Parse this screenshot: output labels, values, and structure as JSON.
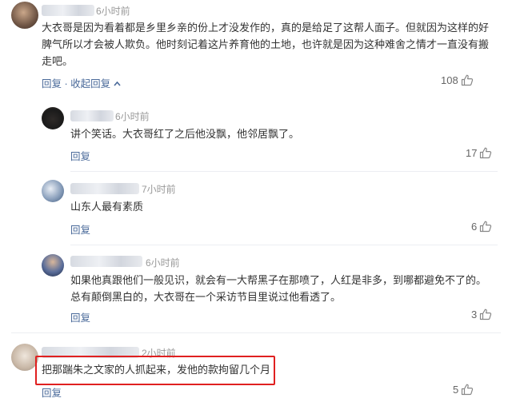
{
  "comments": [
    {
      "time": "6小时前",
      "text": "大衣哥是因为看着都是乡里乡亲的份上才没发作的，真的是给足了这帮人面子。但就因为这样的好脾气所以才会被人欺负。他时刻记着这片养育他的土地，也许就是因为这种难舍之情才一直没有搬走吧。",
      "reply_label": "回复",
      "separator": "·",
      "collapse_label": "收起回复",
      "collapse_icon": "chevron-up-icon",
      "likes": "108"
    },
    {
      "time": "6小时前",
      "text": "讲个笑话。大衣哥红了之后他没飘，他邻居飘了。",
      "reply_label": "回复",
      "likes": "17"
    },
    {
      "time": "7小时前",
      "text": "山东人最有素质",
      "reply_label": "回复",
      "likes": "6"
    },
    {
      "time": "6小时前",
      "text": "如果他真跟他们一般见识，就会有一大帮黑子在那喷了，人红是非多，到哪都避免不了的。总有颠倒黑白的，大衣哥在一个采访节目里说过他看透了。",
      "reply_label": "回复",
      "likes": "3"
    },
    {
      "time": "2小时前",
      "text": "把那踹朱之文家的人抓起来，发他的款拘留几个月",
      "reply_label": "回复",
      "likes": "5"
    }
  ],
  "colors": {
    "link": "#4a6a9a",
    "highlight": "#e02020",
    "time": "#999999"
  }
}
